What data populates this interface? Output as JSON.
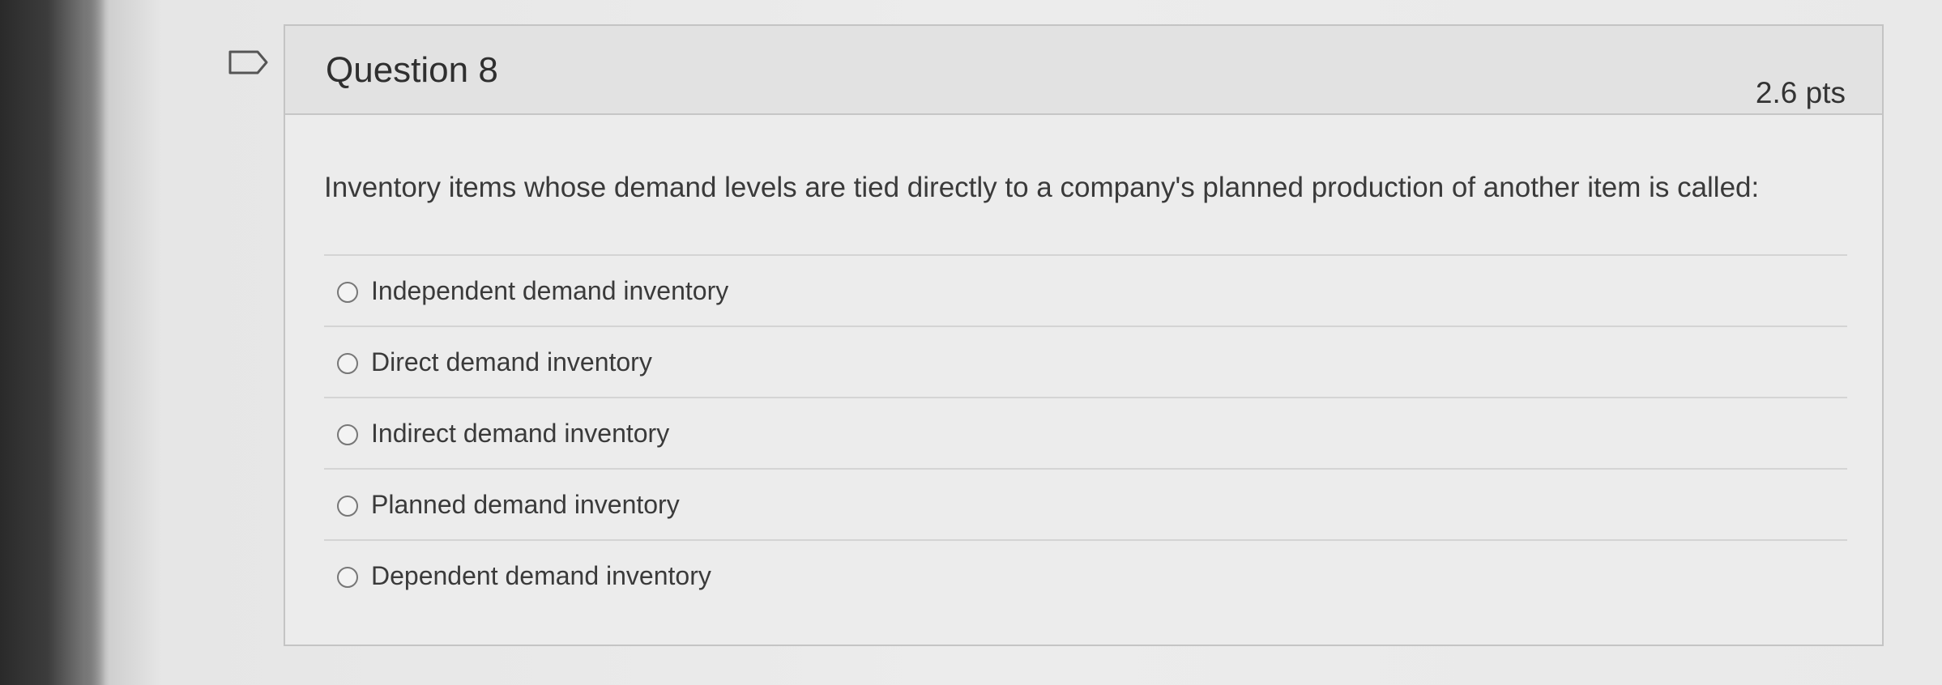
{
  "question": {
    "title": "Question 8",
    "points": "2.6 pts",
    "text": "Inventory items whose demand levels are tied directly to a company's planned production of another item is called:"
  },
  "answers": [
    {
      "label": "Independent demand inventory",
      "selected": false
    },
    {
      "label": "Direct demand inventory",
      "selected": false
    },
    {
      "label": "Indirect demand inventory",
      "selected": false
    },
    {
      "label": "Planned demand inventory",
      "selected": false
    },
    {
      "label": "Dependent demand inventory",
      "selected": false
    }
  ],
  "icons": {
    "flag": "bookmark-flag-icon",
    "radio": "radio-button-icon"
  },
  "colors": {
    "card_background": "#ececec",
    "header_background": "#e2e2e2",
    "border": "#c4c4c4",
    "text": "#3a3a3a"
  }
}
